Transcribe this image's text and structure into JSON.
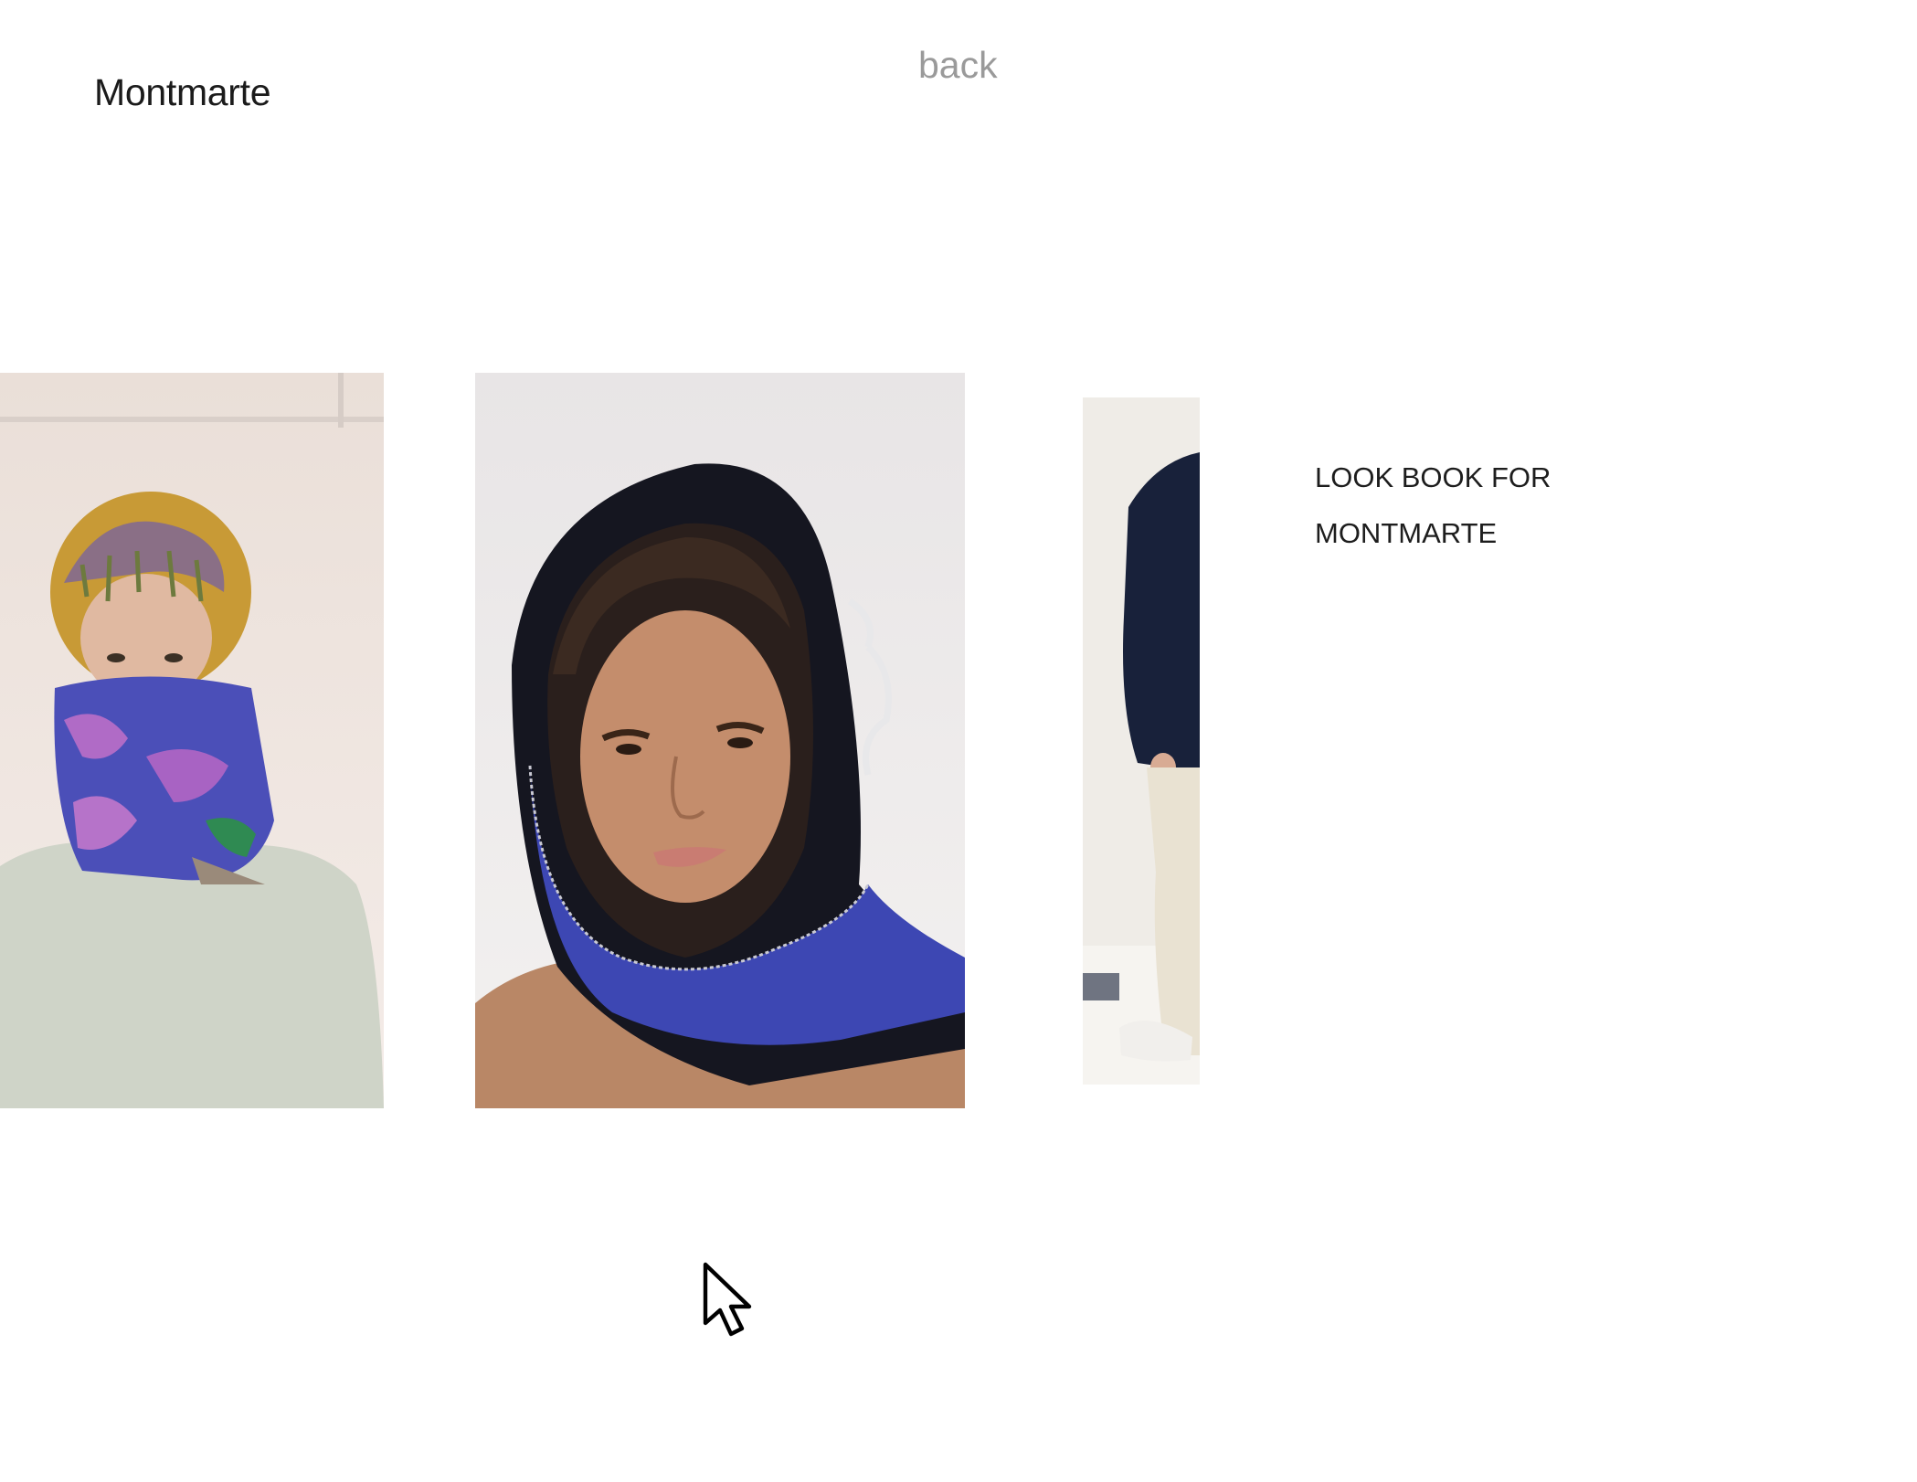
{
  "header": {
    "brand_label": "Montmarte",
    "back_label": "back"
  },
  "gallery": {
    "images": [
      {
        "alt": "Model wearing knitted purple and blue balaclava with fringed mustard hood"
      },
      {
        "alt": "Model wearing black and blue knitted hood scarf"
      },
      {
        "alt": "Model in dark sweater and cream trousers, cropped"
      }
    ]
  },
  "caption": {
    "line1": "LOOK BOOK FOR",
    "line2": "MONTMARTE"
  },
  "colors": {
    "text": "#1b1b1b",
    "muted": "#9a9a9a",
    "background": "#ffffff"
  },
  "icons": {
    "cursor": "arrow-cursor-icon"
  }
}
